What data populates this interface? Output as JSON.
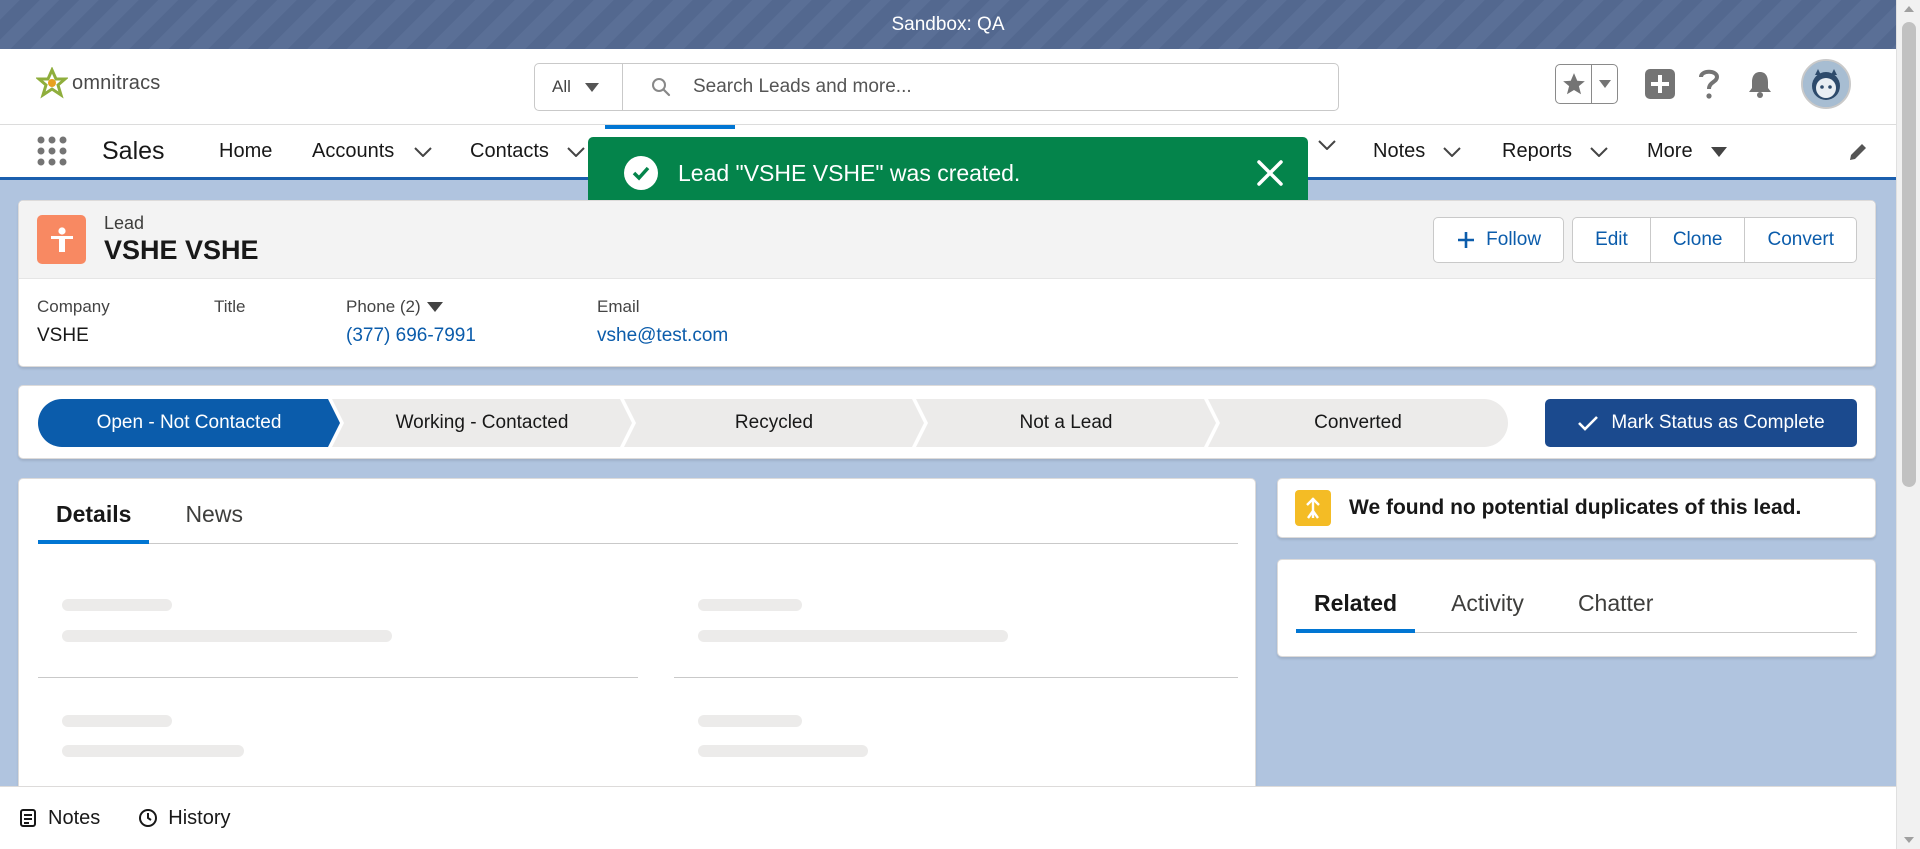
{
  "sandbox": {
    "label": "Sandbox: QA"
  },
  "header": {
    "logo_text": "omnitracs",
    "search": {
      "scope": "All",
      "placeholder": "Search Leads and more..."
    }
  },
  "nav": {
    "app_name": "Sales",
    "items": [
      {
        "label": "Home"
      },
      {
        "label": "Accounts"
      },
      {
        "label": "Contacts"
      },
      {
        "label": "Notes"
      },
      {
        "label": "Reports"
      },
      {
        "label": "More"
      }
    ]
  },
  "toast": {
    "message": "Lead \"VSHE VSHE\" was created."
  },
  "record": {
    "entity_type": "Lead",
    "name": "VSHE VSHE",
    "actions": {
      "follow": "Follow",
      "edit": "Edit",
      "clone": "Clone",
      "convert": "Convert"
    },
    "fields": {
      "company_label": "Company",
      "company_value": "VSHE",
      "title_label": "Title",
      "phone_label": "Phone (2)",
      "phone_value": "(377) 696-7991",
      "email_label": "Email",
      "email_value": "vshe@test.com"
    }
  },
  "path": {
    "steps": [
      {
        "label": "Open - Not Contacted",
        "state": "current"
      },
      {
        "label": "Working - Contacted"
      },
      {
        "label": "Recycled"
      },
      {
        "label": "Not a Lead"
      },
      {
        "label": "Converted"
      }
    ],
    "mark_button": "Mark Status as Complete"
  },
  "details": {
    "tabs": [
      {
        "label": "Details",
        "active": true
      },
      {
        "label": "News"
      }
    ]
  },
  "duplicates": {
    "message": "We found no potential duplicates of this lead."
  },
  "related": {
    "tabs": [
      {
        "label": "Related",
        "active": true
      },
      {
        "label": "Activity"
      },
      {
        "label": "Chatter"
      }
    ]
  },
  "utility": {
    "items": [
      {
        "label": "Notes"
      },
      {
        "label": "History"
      }
    ]
  },
  "colors": {
    "brand": "#0176d3",
    "path_current": "#0b5cab",
    "toast_success": "#04844b",
    "lead_icon": "#f88962",
    "duplicate_icon": "#f4bc25",
    "mark_button": "#1b4a8e"
  },
  "icons": {
    "logo": "omnitracs-logo-icon",
    "search": "search-icon",
    "favorites": "star-icon",
    "global_create": "plus-icon",
    "help": "question-icon",
    "notifications": "bell-icon",
    "launcher": "app-launcher-icon",
    "toast": "check-circle-icon",
    "close": "close-icon",
    "lead": "lead-icon",
    "edit_nav": "pencil-icon",
    "notes": "notes-icon",
    "history": "clock-icon"
  }
}
